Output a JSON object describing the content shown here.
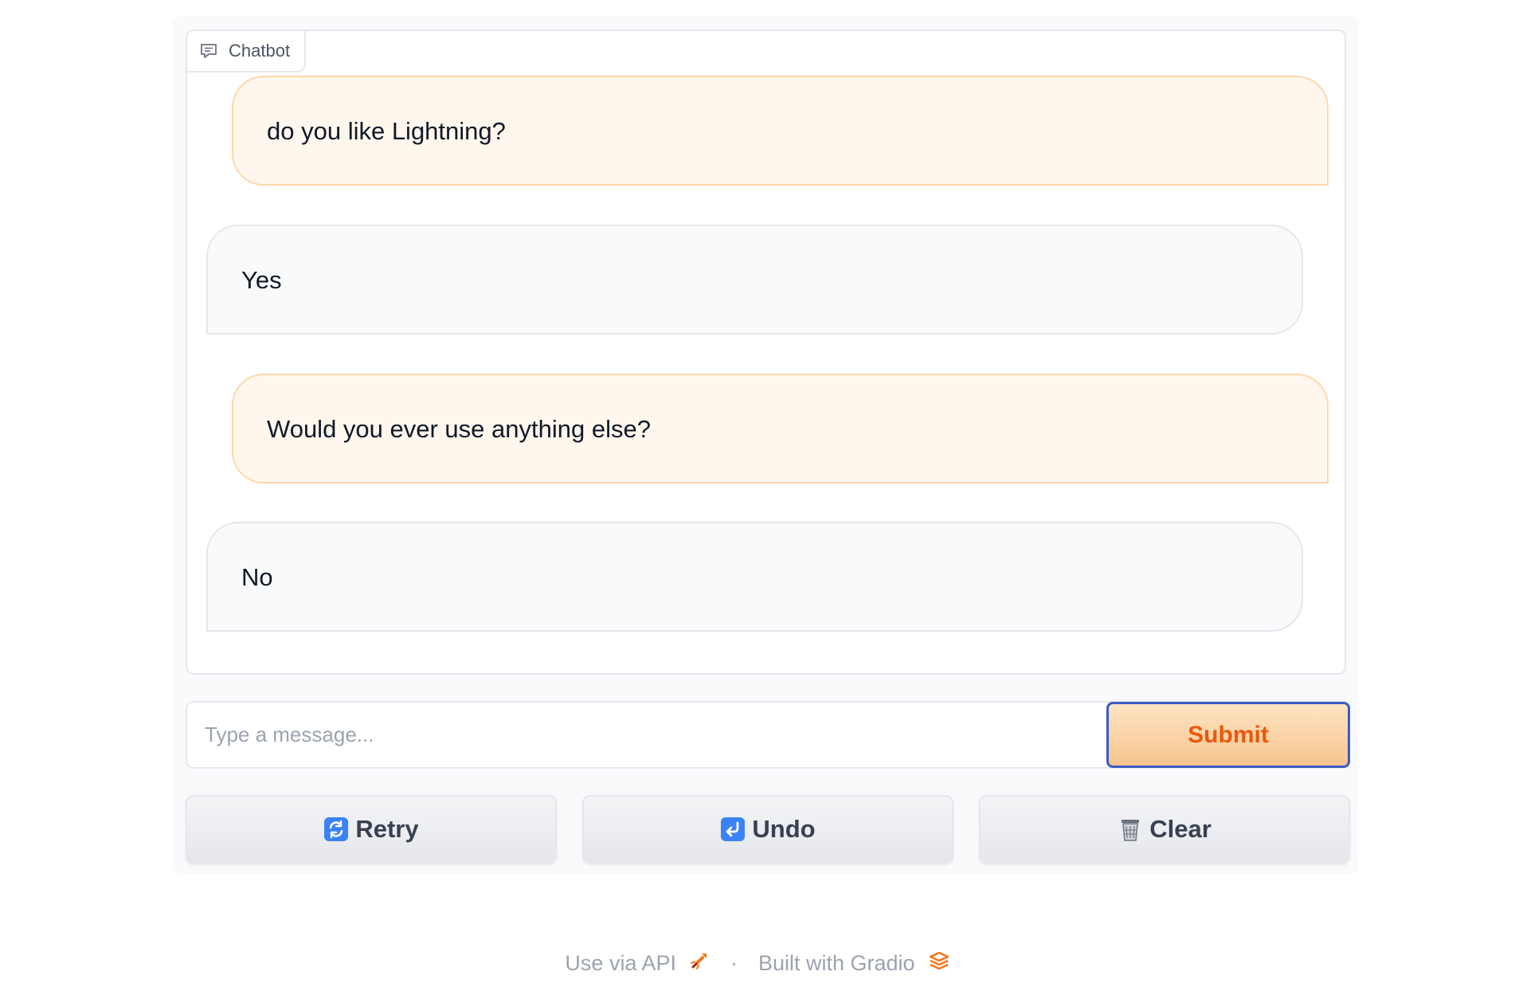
{
  "chatbot": {
    "label": "Chatbot",
    "label_icon": "chat-bubble-icon",
    "messages": [
      {
        "role": "user",
        "text": "do you like Lightning?"
      },
      {
        "role": "bot",
        "text": "Yes"
      },
      {
        "role": "user",
        "text": "Would you ever use anything else?"
      },
      {
        "role": "bot",
        "text": "No"
      }
    ]
  },
  "input": {
    "placeholder": "Type a message...",
    "value": ""
  },
  "submit": {
    "label": "Submit"
  },
  "actions": {
    "retry": {
      "label": "Retry",
      "icon": "retry-arrows-icon"
    },
    "undo": {
      "label": "Undo",
      "icon": "undo-arrow-icon"
    },
    "clear": {
      "label": "Clear",
      "icon": "trash-can-icon"
    }
  },
  "footer": {
    "api_link": "Use via API",
    "api_icon": "rocket-icon",
    "separator": "·",
    "built_with": "Built with Gradio",
    "gradio_icon": "gradio-logo-icon"
  },
  "colors": {
    "accent": "#ea580c",
    "user_bubble": "#fff7ed",
    "bot_bubble": "#f9fafb",
    "submit_border": "#3b5cc4"
  }
}
